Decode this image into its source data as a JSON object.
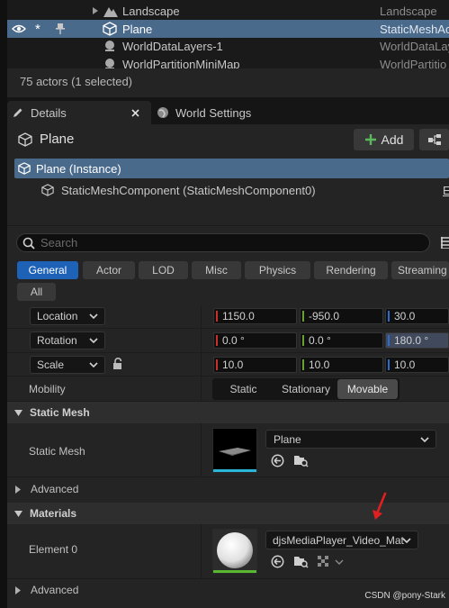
{
  "outliner": {
    "rows": [
      {
        "name": "Landscape",
        "type": "Landscape"
      },
      {
        "name": "Plane",
        "type": "StaticMeshAc"
      },
      {
        "name": "WorldDataLayers-1",
        "type": "WorldDataLay"
      },
      {
        "name": "WorldPartitionMiniMap",
        "type": "WorldPartitio"
      }
    ],
    "status": "75 actors (1 selected)"
  },
  "tabs": {
    "details": "Details",
    "world_settings": "World Settings"
  },
  "details": {
    "actor_name": "Plane",
    "add_label": "Add",
    "instance_label": "Plane (Instance)",
    "component_label": "StaticMeshComponent (StaticMeshComponent0)",
    "component_edit": "E",
    "search_placeholder": "Search",
    "filter_tabs": [
      "General",
      "Actor",
      "LOD",
      "Misc",
      "Physics",
      "Rendering",
      "Streaming",
      "All"
    ],
    "transform": {
      "location": {
        "label": "Location",
        "x": "1150.0",
        "y": "-950.0",
        "z": "30.0"
      },
      "rotation": {
        "label": "Rotation",
        "x": "0.0 °",
        "y": "0.0 °",
        "z": "180.0 °"
      },
      "scale": {
        "label": "Scale",
        "x": "10.0",
        "y": "10.0",
        "z": "10.0"
      }
    },
    "mobility": {
      "label": "Mobility",
      "options": [
        "Static",
        "Stationary",
        "Movable"
      ],
      "selected": "Movable"
    },
    "static_mesh_section": {
      "title": "Static Mesh",
      "label": "Static Mesh",
      "value": "Plane"
    },
    "advanced_label_1": "Advanced",
    "materials_section": {
      "title": "Materials",
      "element_label": "Element 0",
      "value": "djsMediaPlayer_Video_Mat"
    },
    "advanced_label_2": "Advanced"
  },
  "watermark": "CSDN @pony-Stark",
  "colors": {
    "selection": "#4a6a8c",
    "accent": "#1e62b8",
    "x_axis": "#c8302c",
    "y_axis": "#6aa030",
    "z_axis": "#2a6cd0",
    "annotation_arrow": "#e02020"
  }
}
